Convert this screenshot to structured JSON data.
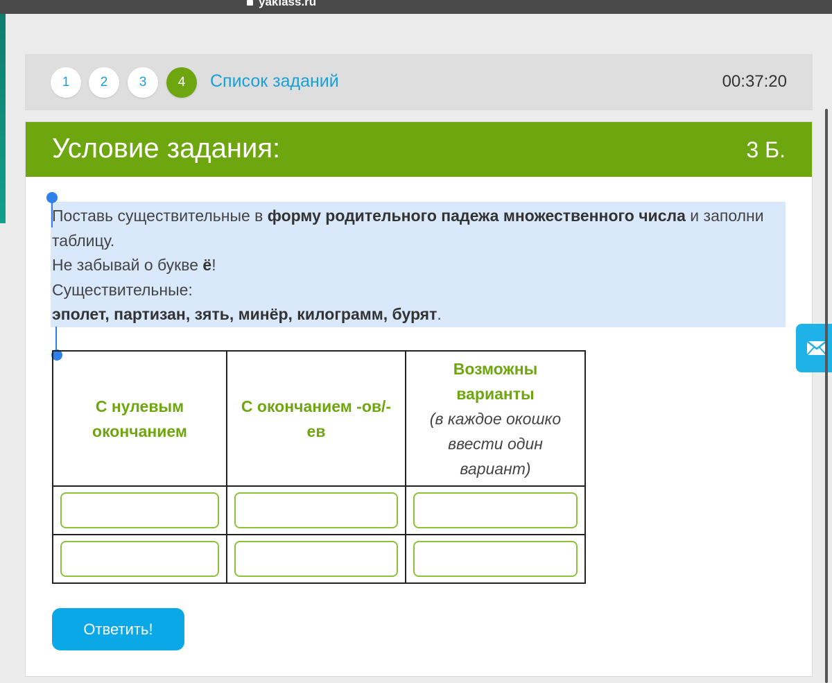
{
  "browser": {
    "url": "yaklass.ru"
  },
  "nav": {
    "task_numbers": [
      "1",
      "2",
      "3",
      "4"
    ],
    "active_index": 3,
    "task_list_label": "Список заданий",
    "timer": "00:37:20"
  },
  "task": {
    "title": "Условие задания:",
    "points": "3 Б.",
    "text": {
      "line1_start": "Поставь существительные в ",
      "line1_bold": "форму родительного падежа множественного числа",
      "line1_end": " и заполни таблицу.",
      "line2_start": "Не забывай о букве ",
      "line2_letter": "ё",
      "line2_end": "!",
      "line3": "Существительные:",
      "line4_bold": "эполет, партизан, зять, минёр, килограмм, бурят",
      "line4_end": "."
    }
  },
  "table": {
    "headers": [
      {
        "title": "С нулевым окончанием",
        "note": ""
      },
      {
        "title": "С окончанием -ов/-ев",
        "note": ""
      },
      {
        "title": "Возможны варианты",
        "note": "(в каждое окошко ввести один вариант)"
      }
    ],
    "rows": [
      [
        "",
        "",
        ""
      ],
      [
        "",
        "",
        ""
      ]
    ]
  },
  "submit_label": "Ответить!",
  "icons": {
    "mail": "envelope-icon",
    "lock": "lock-icon"
  },
  "colors": {
    "accent_green": "#6ea610",
    "link_blue": "#1aa0d8",
    "button_blue": "#0aa8e6",
    "selection": "#d9e8fb"
  }
}
